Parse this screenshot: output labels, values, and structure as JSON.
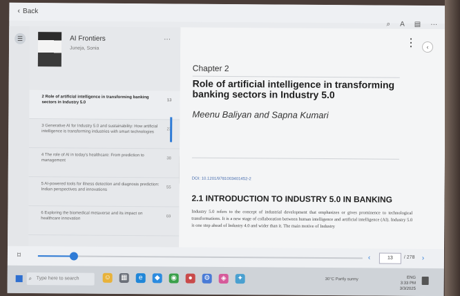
{
  "topbar": {
    "back_label": "Back"
  },
  "book": {
    "title": "AI Frontiers",
    "author": "Juneja, Sonia"
  },
  "toc": [
    {
      "label": "2 Role of artificial intelligence in transforming banking sectors in Industry 5.0",
      "page": "13",
      "active": true
    },
    {
      "label": "3 Generative AI for Industry 5.0 and sustainability: How artificial intelligence is transforming industries with smart technologies",
      "page": "23"
    },
    {
      "label": "4 The role of AI in today's healthcare: From prediction to management",
      "page": "38"
    },
    {
      "label": "5 AI-powered tools for illness detection and diagnosis prediction: Indian perspectives and innovations",
      "page": "55"
    },
    {
      "label": "6 Exploring the biomedical metaverse and its impact on healthcare innovation",
      "page": "69"
    }
  ],
  "page": {
    "chapter": "Chapter 2",
    "title": "Role of artificial intelligence in transforming banking sectors in Industry 5.0",
    "authors": "Meenu Baliyan and Sapna Kumari",
    "doi": "DOI: 10.1201/9781003401452-2",
    "section": "2.1  INTRODUCTION TO INDUSTRY 5.0 IN BANKING",
    "body": "Industry 5.0 refers to the concept of industrial development that emphasizes or gives prominence to technological transformations. It is a new stage of collaboration between human intelligence and artificial intelligence (AI). Industry 5.0 is one step ahead of Industry 4.0 and wider than it. The main motive of Industry"
  },
  "nav": {
    "current_page": "13",
    "total": "/ 278",
    "progress": 0.11
  },
  "taskbar": {
    "search_placeholder": "Type here to search",
    "weather": "30°C  Partly sunny",
    "lang": "ENG",
    "time": "3:33 PM",
    "date": "3/3/2025"
  }
}
